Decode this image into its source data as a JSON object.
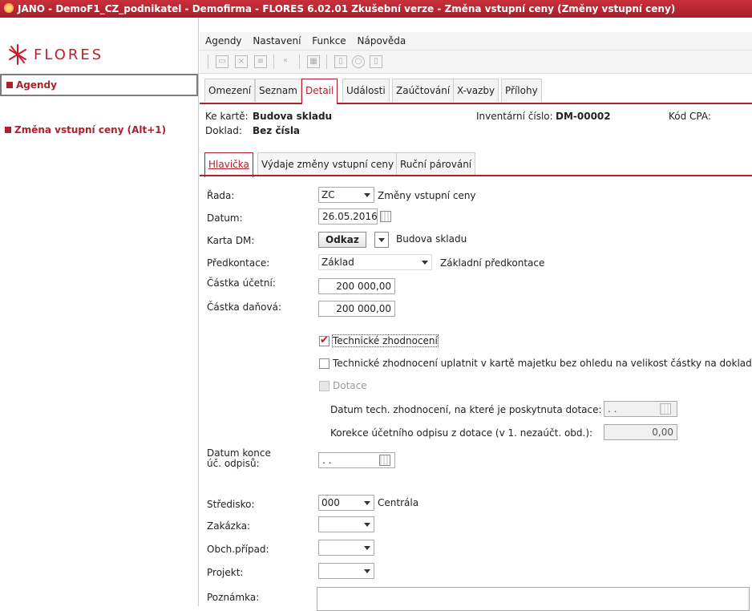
{
  "window": {
    "title": "JANO - DemoF1_CZ_podnikatel - Demofirma - FLORES 6.02.01 Zkušební verze - Změna vstupní ceny  (Změny vstupní ceny)"
  },
  "sidebar": {
    "logo_text": "FLORES",
    "agendy_label": "Agendy",
    "item_label": "Změna vstupní ceny (Alt+1)"
  },
  "menu": [
    "Agendy",
    "Nastavení",
    "Funkce",
    "Nápověda"
  ],
  "toolbar_icons": [
    "open-folder-icon",
    "close-icon",
    "grid-icon",
    "back-icon",
    "table-icon",
    "info-icon",
    "search-icon",
    "help-icon"
  ],
  "top_tabs": [
    "Omezení",
    "Seznam",
    "Detail",
    "Události",
    "Zaúčtování",
    "X-vazby",
    "Přílohy"
  ],
  "header": {
    "ke_karte_label": "Ke kartě:",
    "ke_karte_value": "Budova skladu",
    "doklad_label": "Doklad:",
    "doklad_value": "Bez čísla",
    "inv_label": "Inventární číslo:",
    "inv_value": "DM-00002",
    "cpa_label": "Kód CPA:"
  },
  "sub_tabs": [
    "Hlavička",
    "Výdaje změny vstupní ceny",
    "Ruční párování"
  ],
  "form": {
    "rada_label": "Řada:",
    "rada_value": "ZC",
    "rada_desc": "Změny vstupní ceny",
    "datum_label": "Datum:",
    "datum_value": "26.05.2016",
    "karta_label": "Karta DM:",
    "karta_button": "Odkaz",
    "karta_desc": "Budova skladu",
    "predkontace_label": "Předkontace:",
    "predkontace_value": "Základ",
    "predkontace_desc": "Základní předkontace",
    "castka_ucetni_label": "Částka účetní:",
    "castka_ucetni_value": "200 000,00",
    "castka_danova_label": "Částka daňová:",
    "castka_danova_value": "200 000,00",
    "tech_zhodnoceni_label": "Technické zhodnocení",
    "tech_zhodnoceni_checked": true,
    "tech_uplatnit_label": "Technické zhodnocení uplatnit v kartě majetku bez ohledu na velikost částky na dokladu.",
    "tech_uplatnit_checked": false,
    "dotace_label": "Dotace",
    "dotace_checked": false,
    "datum_tech_label": "Datum tech. zhodnocení, na které je poskytnuta dotace:",
    "datum_tech_value": ". .",
    "korekce_label": "Korekce účetního odpisu z dotace (v 1. nezaúčt. obd.):",
    "korekce_value": "0,00",
    "datum_konce_label_1": "Datum konce",
    "datum_konce_label_2": "úč. odpisů:",
    "datum_konce_value": ". .",
    "stredisko_label": "Středisko:",
    "stredisko_value": "000",
    "stredisko_desc": "Centrála",
    "zakazka_label": "Zakázka:",
    "obch_pripad_label": "Obch.případ:",
    "projekt_label": "Projekt:",
    "poznamka_label": "Poznámka:"
  },
  "colors": {
    "accent": "#b0202c",
    "title_bar": "#b8262f"
  }
}
